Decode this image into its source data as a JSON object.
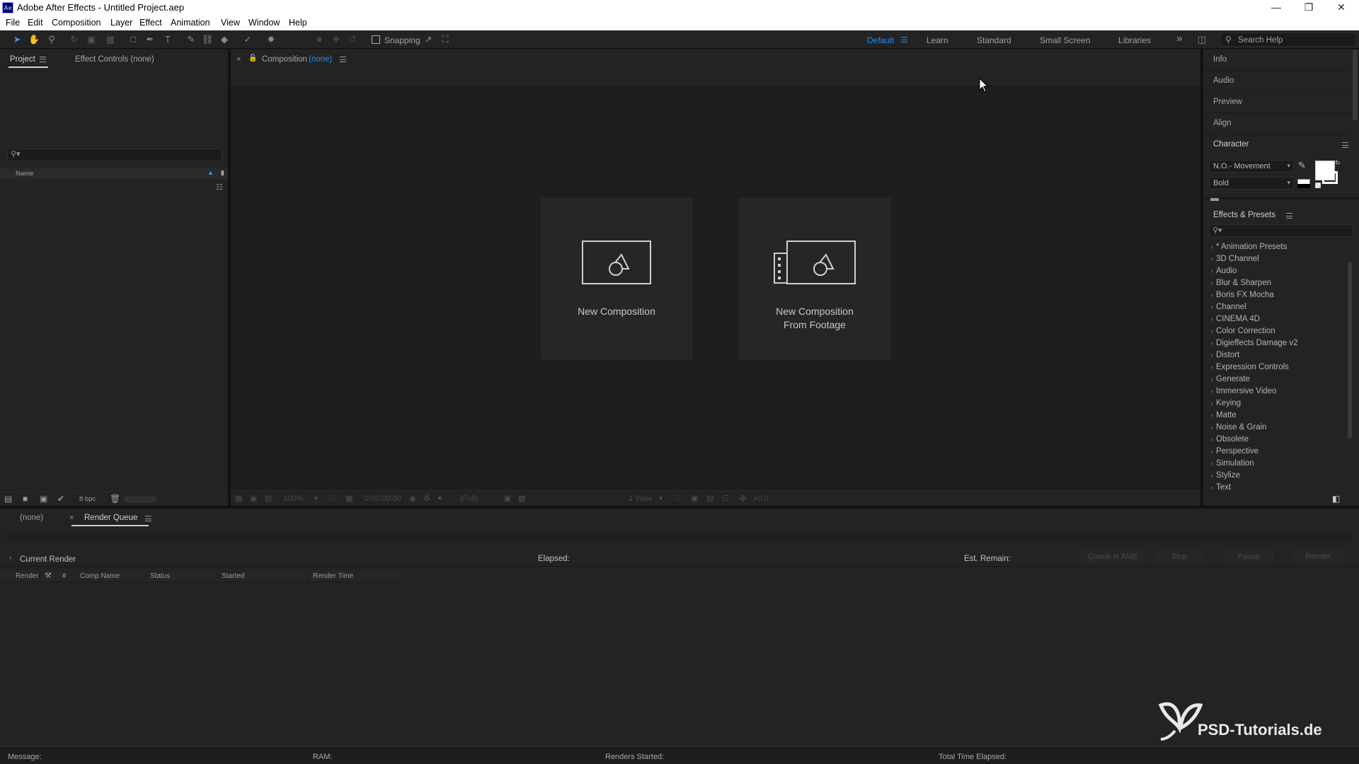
{
  "app": {
    "title": "Adobe After Effects - Untitled Project.aep",
    "icon_label": "Ae"
  },
  "menu": [
    "File",
    "Edit",
    "Composition",
    "Layer",
    "Effect",
    "Animation",
    "View",
    "Window",
    "Help"
  ],
  "toolbar": {
    "snapping_label": "Snapping",
    "workspaces": [
      "Default",
      "Learn",
      "Standard",
      "Small Screen",
      "Libraries"
    ],
    "active_workspace": "Default",
    "search_placeholder": "Search Help",
    "overflow": "»"
  },
  "project_panel": {
    "tab_project": "Project",
    "tab_effect_controls": "Effect Controls (none)",
    "search_placeholder": "",
    "column_name": "Name",
    "bpc": "8 bpc"
  },
  "composition_panel": {
    "tab_label": "Composition",
    "tab_value": "(none)",
    "card_new_composition": "New Composition",
    "card_from_footage_line1": "New Composition",
    "card_from_footage_line2": "From Footage",
    "footer": {
      "zoom": "100%",
      "timecode": "0:00:00:00",
      "resolution": "(Full)",
      "views": "1 View",
      "exposure": "+0.0"
    }
  },
  "right_panels": {
    "info": "Info",
    "audio": "Audio",
    "preview": "Preview",
    "align": "Align",
    "character": "Character",
    "font_family": "N.O.- Movement",
    "font_style": "Bold",
    "effects_presets": "Effects & Presets"
  },
  "effects_list": [
    "* Animation Presets",
    "3D Channel",
    "Audio",
    "Blur & Sharpen",
    "Boris FX Mocha",
    "Channel",
    "CINEMA 4D",
    "Color Correction",
    "Digieffects Damage v2",
    "Distort",
    "Expression Controls",
    "Generate",
    "Immersive Video",
    "Keying",
    "Matte",
    "Noise & Grain",
    "Obsolete",
    "Perspective",
    "Simulation",
    "Stylize",
    "Text"
  ],
  "render_queue": {
    "tab_none": "(none)",
    "tab_render_queue": "Render Queue",
    "current_render": "Current Render",
    "elapsed": "Elapsed:",
    "est_remain": "Est. Remain:",
    "buttons": [
      "Queue in AME",
      "Stop",
      "Pause",
      "Render"
    ],
    "columns": [
      "Render",
      "#",
      "Comp Name",
      "Status",
      "Started",
      "Render Time"
    ]
  },
  "status_bar": {
    "message": "Message:",
    "ram": "RAM:",
    "renders_started": "Renders Started:",
    "total_time_elapsed": "Total Time Elapsed:"
  },
  "watermark": "PSD-Tutorials.de",
  "colors": {
    "accent_blue": "#2d8ceb",
    "panel_bg": "#232323",
    "app_bg": "#1d1d1d"
  }
}
